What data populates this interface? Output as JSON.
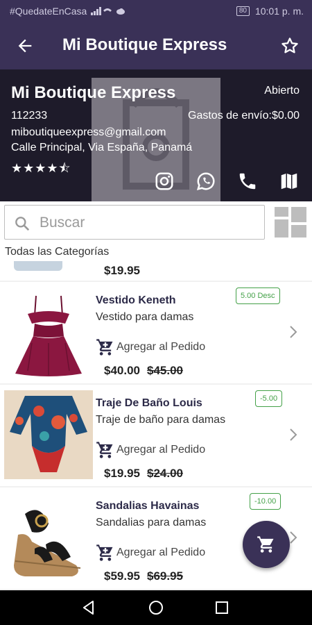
{
  "status_bar": {
    "hashtag": "#QuedateEnCasa",
    "battery": "80",
    "time": "10:01 p. m."
  },
  "app_bar": {
    "title": "Mi Boutique Express",
    "back_icon": "arrow-left-icon",
    "favorite_icon": "star-outline-icon"
  },
  "store": {
    "name": "Mi Boutique Express",
    "status": "Abierto",
    "code": "112233",
    "shipping": "Gastos de envío:$0.00",
    "email": "miboutiqueexpress@gmail.com",
    "address": "Calle Principal, Via España, Panamá",
    "rating_stars": "★★★★⯪",
    "rating_value": 4.5,
    "actions": [
      "instagram-icon",
      "whatsapp-icon",
      "phone-icon",
      "map-icon"
    ]
  },
  "search": {
    "placeholder": "Buscar",
    "value": ""
  },
  "category_filter": "Todas las Categorías",
  "partial_item": {
    "price": "$19.95"
  },
  "products": [
    {
      "name": "Vestido Keneth",
      "description": "Vestido para damas",
      "add_label": "Agregar al Pedido",
      "price": "$40.00",
      "old_price": "$45.00",
      "badge": "5.00 Desc"
    },
    {
      "name": "Traje De Baño Louis",
      "description": "Traje de baño para damas",
      "add_label": "Agregar al Pedido",
      "price": "$19.95",
      "old_price": "$24.00",
      "badge": "-5.00"
    },
    {
      "name": "Sandalias Havainas",
      "description": "Sandalias para damas",
      "add_label": "Agregar al Pedido",
      "price": "$59.95",
      "old_price": "$69.95",
      "badge": "-10.00"
    }
  ],
  "colors": {
    "primary": "#3a3157",
    "header_bg": "#1e1b2a",
    "discount_green": "#43a047"
  }
}
